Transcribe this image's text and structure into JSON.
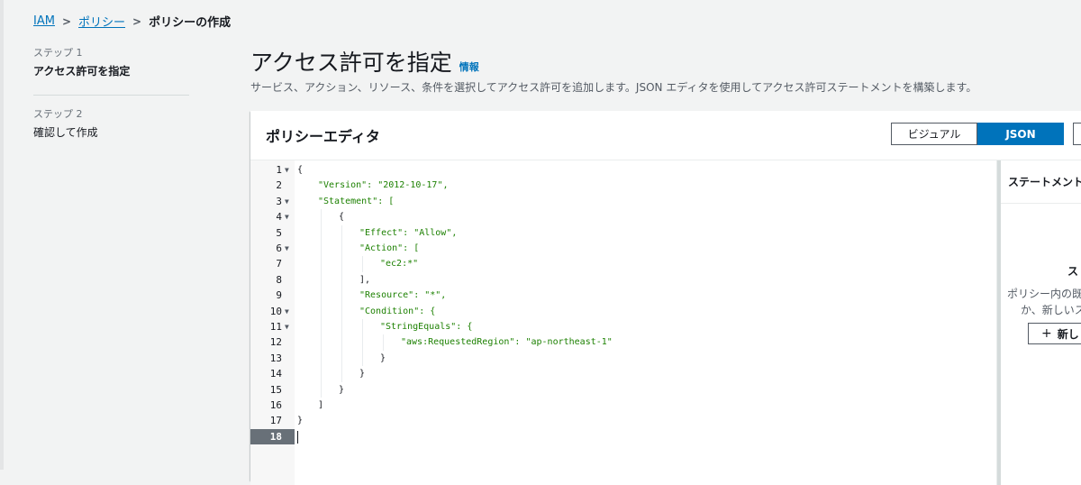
{
  "breadcrumb": {
    "items": [
      "IAM",
      "ポリシー"
    ],
    "current": "ポリシーの作成"
  },
  "steps": [
    {
      "number": "ステップ 1",
      "title": "アクセス許可を指定",
      "active": true
    },
    {
      "number": "ステップ 2",
      "title": "確認して作成",
      "active": false
    }
  ],
  "page": {
    "title": "アクセス許可を指定",
    "info_label": "情報",
    "description": "サービス、アクション、リソース、条件を選択してアクセス許可を追加します。JSON エディタを使用してアクセス許可ステートメントを構築します。"
  },
  "editor": {
    "title": "ポリシーエディタ",
    "mode_visual": "ビジュアル",
    "mode_json": "JSON",
    "active_mode": "JSON",
    "active_line": 18,
    "lines": [
      {
        "n": "1",
        "fold": true,
        "indent": 0,
        "text": "{"
      },
      {
        "n": "2",
        "fold": false,
        "indent": 1,
        "text": "\"Version\": \"2012-10-17\","
      },
      {
        "n": "3",
        "fold": true,
        "indent": 1,
        "text": "\"Statement\": ["
      },
      {
        "n": "4",
        "fold": true,
        "indent": 2,
        "text": "{"
      },
      {
        "n": "5",
        "fold": false,
        "indent": 3,
        "text": "\"Effect\": \"Allow\","
      },
      {
        "n": "6",
        "fold": true,
        "indent": 3,
        "text": "\"Action\": ["
      },
      {
        "n": "7",
        "fold": false,
        "indent": 4,
        "text": "\"ec2:*\""
      },
      {
        "n": "8",
        "fold": false,
        "indent": 3,
        "text": "],"
      },
      {
        "n": "9",
        "fold": false,
        "indent": 3,
        "text": "\"Resource\": \"*\","
      },
      {
        "n": "10",
        "fold": true,
        "indent": 3,
        "text": "\"Condition\": {"
      },
      {
        "n": "11",
        "fold": true,
        "indent": 4,
        "text": "\"StringEquals\": {"
      },
      {
        "n": "12",
        "fold": false,
        "indent": 5,
        "text": "\"aws:RequestedRegion\": \"ap-northeast-1\""
      },
      {
        "n": "13",
        "fold": false,
        "indent": 4,
        "text": "}"
      },
      {
        "n": "14",
        "fold": false,
        "indent": 3,
        "text": "}"
      },
      {
        "n": "15",
        "fold": false,
        "indent": 2,
        "text": "}"
      },
      {
        "n": "16",
        "fold": false,
        "indent": 1,
        "text": "]"
      },
      {
        "n": "17",
        "fold": false,
        "indent": 0,
        "text": "}"
      },
      {
        "n": "18",
        "fold": false,
        "indent": 0,
        "text": ""
      }
    ]
  },
  "statement_panel": {
    "title": "ステートメント",
    "empty_title": "ス",
    "empty_desc_line1": "ポリシー内の既",
    "empty_desc_line2": "か、新しいス",
    "add_button_label": "新し"
  },
  "colors": {
    "accent": "#0073bb",
    "string": "#1d8102",
    "background": "#f2f3f3"
  }
}
